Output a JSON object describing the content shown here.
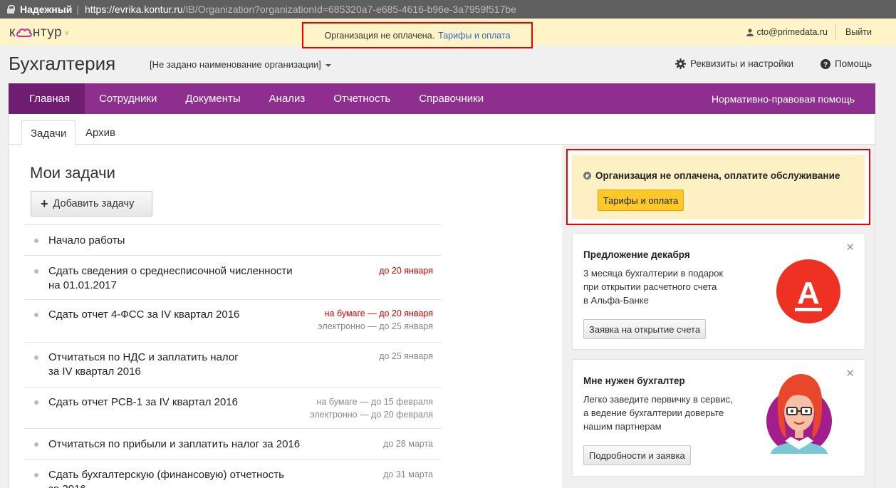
{
  "browser": {
    "secure_label": "Надежный",
    "url_host": "https://evrika.kontur.ru",
    "url_path": "/IB/Organization?organizationId=685320a7-e685-4616-b96e-3a7959f517be"
  },
  "topbar": {
    "logo_prefix": "к",
    "logo_suffix": "нтур",
    "banner_text": "Организация не оплачена.",
    "banner_link": "Тарифы и оплата",
    "user_email": "cto@primedata.ru",
    "logout_label": "Выйти"
  },
  "header": {
    "title": "Бухгалтерия",
    "org_selector": "[Не задано наименование организации]",
    "settings_label": "Реквизиты и настройки",
    "help_label": "Помощь"
  },
  "nav": {
    "items": [
      "Главная",
      "Сотрудники",
      "Документы",
      "Анализ",
      "Отчетность",
      "Справочники"
    ],
    "right_label": "Нормативно-правовая помощь"
  },
  "subtabs": {
    "tasks": "Задачи",
    "archive": "Архив"
  },
  "tasks": {
    "title": "Мои задачи",
    "add_button": "Добавить задачу",
    "items": [
      {
        "line1": "Начало работы",
        "line2": "",
        "due1": "",
        "due2": ""
      },
      {
        "line1": "Сдать сведения о среднесписочной численности",
        "line2": "на 01.01.2017",
        "due1": "до 20 января",
        "due2": ""
      },
      {
        "line1": "Сдать отчет 4-ФСС за IV квартал 2016",
        "line2": "",
        "due1": "на бумаге — до 20 января",
        "due2": "электронно — до 25 января"
      },
      {
        "line1": "Отчитаться по НДС и заплатить налог",
        "line2": "за IV квартал 2016",
        "due1": "до 25 января",
        "due2": ""
      },
      {
        "line1": "Сдать отчет РСВ-1 за IV квартал 2016",
        "line2": "",
        "due1": "на бумаге — до 15 февраля",
        "due2": "электронно — до 20 февраля"
      },
      {
        "line1": "Отчитаться по прибыли и заплатить налог за 2016",
        "line2": "",
        "due1": "до 28 марта",
        "due2": ""
      },
      {
        "line1": "Сдать бухгалтерскую (финансовую) отчетность",
        "line2": "за 2016",
        "due1": "до 31 марта",
        "due2": ""
      }
    ]
  },
  "notice": {
    "title": "Организация не оплачена, оплатите обслуживание",
    "button": "Тарифы и оплата"
  },
  "promo1": {
    "title": "Предложение декабря",
    "text_lines": [
      "3 месяца бухгалтерии в подарок",
      "при открытии расчетного счета",
      "в Альфа-Банке"
    ],
    "button": "Заявка на открытие счета",
    "logo_letter": "А"
  },
  "promo2": {
    "title": "Мне нужен бухгалтер",
    "text_lines": [
      "Легко заведите первичку в сервис,",
      "а ведение бухгалтерии доверьте",
      "нашим партнерам"
    ],
    "button": "Подробности и заявка"
  },
  "colors": {
    "nav_purple": "#8e2f8f",
    "nav_active": "#6e1d70",
    "banner_yellow": "#fef4c8",
    "highlight_red": "#ee0000",
    "alfa_red": "#ef3124",
    "button_yellow": "#fcc829"
  }
}
